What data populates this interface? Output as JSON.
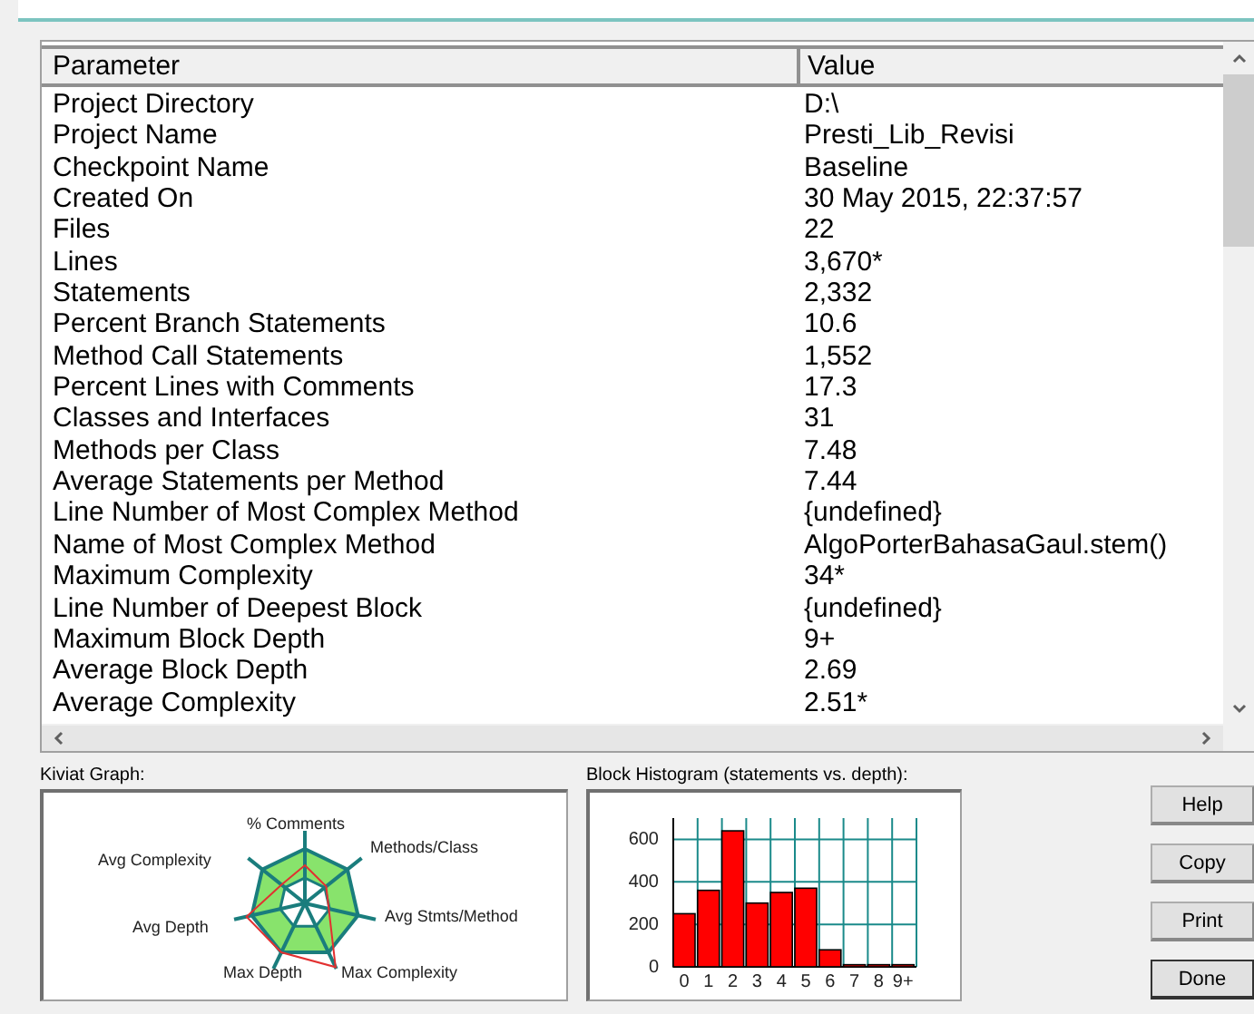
{
  "table": {
    "columns": [
      "Parameter",
      "Value"
    ],
    "rows": [
      [
        "Project Directory",
        "D:\\"
      ],
      [
        "Project Name",
        "Presti_Lib_Revisi"
      ],
      [
        "Checkpoint Name",
        "Baseline"
      ],
      [
        "Created On",
        "30 May 2015, 22:37:57"
      ],
      [
        "Files",
        "22"
      ],
      [
        "Lines",
        "3,670*"
      ],
      [
        "Statements",
        "2,332"
      ],
      [
        "Percent Branch Statements",
        "10.6"
      ],
      [
        "Method Call Statements",
        "1,552"
      ],
      [
        "Percent Lines with Comments",
        "17.3"
      ],
      [
        "Classes and Interfaces",
        "31"
      ],
      [
        "Methods per Class",
        "7.48"
      ],
      [
        "Average Statements per Method",
        "7.44"
      ],
      [
        "Line Number of Most Complex Method",
        "{undefined}"
      ],
      [
        "Name of Most Complex Method",
        "AlgoPorterBahasaGaul.stem()"
      ],
      [
        "Maximum Complexity",
        "34*"
      ],
      [
        "Line Number of Deepest Block",
        "{undefined}"
      ],
      [
        "Maximum Block Depth",
        "9+"
      ],
      [
        "Average Block Depth",
        "2.69"
      ],
      [
        "Average Complexity",
        "2.51*"
      ]
    ]
  },
  "kiviat": {
    "title": "Kiviat Graph:",
    "axes": [
      "% Comments",
      "Methods/Class",
      "Avg Complexity",
      "Avg Stmts/Method",
      "Avg Depth",
      "Max Depth",
      "Max Complexity"
    ]
  },
  "histogram": {
    "title": "Block Histogram (statements vs. depth):",
    "chart_data": {
      "type": "bar",
      "categories": [
        "0",
        "1",
        "2",
        "3",
        "4",
        "5",
        "6",
        "7",
        "8",
        "9+"
      ],
      "values": [
        250,
        360,
        640,
        300,
        350,
        370,
        80,
        10,
        10,
        10
      ],
      "ylim": [
        0,
        700
      ],
      "yticks": [
        0,
        200,
        400,
        600
      ],
      "grid": true
    }
  },
  "buttons": [
    "Help",
    "Copy",
    "Print",
    "Done"
  ]
}
